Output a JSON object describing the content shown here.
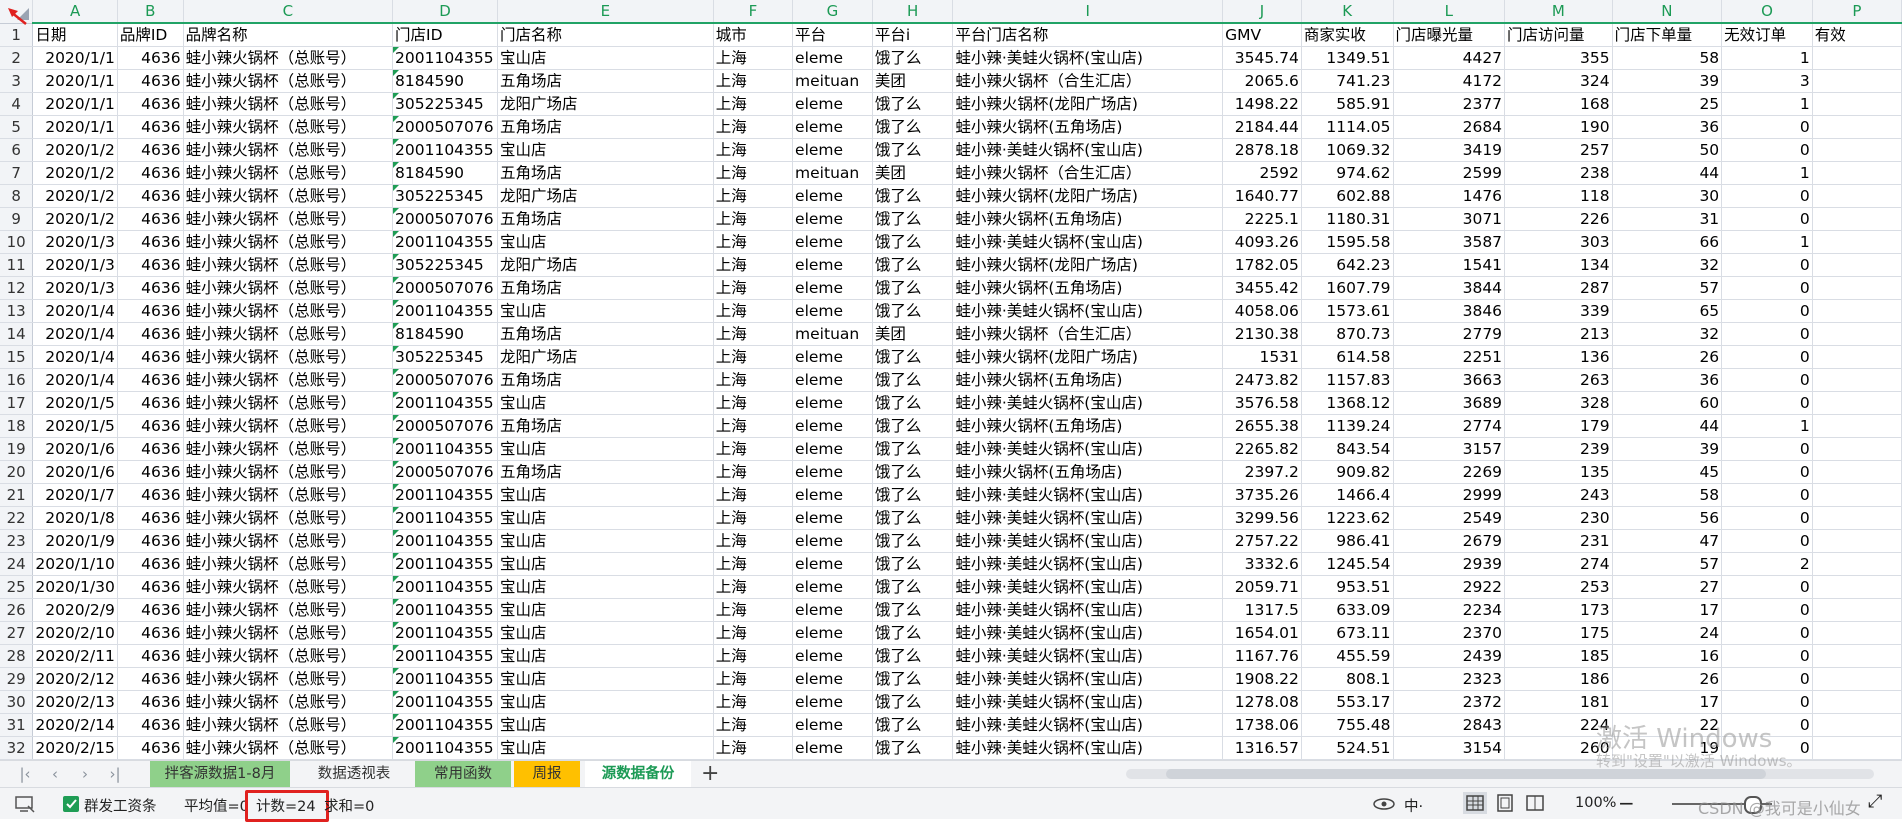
{
  "columns": [
    "A",
    "B",
    "C",
    "D",
    "E",
    "F",
    "G",
    "H",
    "I",
    "J",
    "K",
    "L",
    "M",
    "N",
    "O",
    "P"
  ],
  "header_row": [
    "日期",
    "品牌ID",
    "品牌名称",
    "门店ID",
    "门店名称",
    "城市",
    "平台",
    "平台i",
    "平台门店名称",
    "GMV",
    "商家实收",
    "门店曝光量",
    "门店访问量",
    "门店下单量",
    "无效订单",
    "有效"
  ],
  "rows": [
    [
      "2",
      "2020/1/1",
      "4636",
      "蛙小辣火锅杯（总账号）",
      "2001104355",
      "宝山店",
      "上海",
      "eleme",
      "饿了么",
      "蛙小辣·美蛙火锅杯(宝山店)",
      "3545.74",
      "1349.51",
      "4427",
      "355",
      "58",
      "1"
    ],
    [
      "3",
      "2020/1/1",
      "4636",
      "蛙小辣火锅杯（总账号）",
      "8184590",
      "五角场店",
      "上海",
      "meituan",
      "美团",
      "蛙小辣火锅杯（合生汇店）",
      "2065.6",
      "741.23",
      "4172",
      "324",
      "39",
      "3"
    ],
    [
      "4",
      "2020/1/1",
      "4636",
      "蛙小辣火锅杯（总账号）",
      "305225345",
      "龙阳广场店",
      "上海",
      "eleme",
      "饿了么",
      "蛙小辣火锅杯(龙阳广场店)",
      "1498.22",
      "585.91",
      "2377",
      "168",
      "25",
      "1"
    ],
    [
      "5",
      "2020/1/1",
      "4636",
      "蛙小辣火锅杯（总账号）",
      "2000507076",
      "五角场店",
      "上海",
      "eleme",
      "饿了么",
      "蛙小辣火锅杯(五角场店)",
      "2184.44",
      "1114.05",
      "2684",
      "190",
      "36",
      "0"
    ],
    [
      "6",
      "2020/1/2",
      "4636",
      "蛙小辣火锅杯（总账号）",
      "2001104355",
      "宝山店",
      "上海",
      "eleme",
      "饿了么",
      "蛙小辣·美蛙火锅杯(宝山店)",
      "2878.18",
      "1069.32",
      "3419",
      "257",
      "50",
      "0"
    ],
    [
      "7",
      "2020/1/2",
      "4636",
      "蛙小辣火锅杯（总账号）",
      "8184590",
      "五角场店",
      "上海",
      "meituan",
      "美团",
      "蛙小辣火锅杯（合生汇店）",
      "2592",
      "974.62",
      "2599",
      "238",
      "44",
      "1"
    ],
    [
      "8",
      "2020/1/2",
      "4636",
      "蛙小辣火锅杯（总账号）",
      "305225345",
      "龙阳广场店",
      "上海",
      "eleme",
      "饿了么",
      "蛙小辣火锅杯(龙阳广场店)",
      "1640.77",
      "602.88",
      "1476",
      "118",
      "30",
      "0"
    ],
    [
      "9",
      "2020/1/2",
      "4636",
      "蛙小辣火锅杯（总账号）",
      "2000507076",
      "五角场店",
      "上海",
      "eleme",
      "饿了么",
      "蛙小辣火锅杯(五角场店)",
      "2225.1",
      "1180.31",
      "3071",
      "226",
      "31",
      "0"
    ],
    [
      "10",
      "2020/1/3",
      "4636",
      "蛙小辣火锅杯（总账号）",
      "2001104355",
      "宝山店",
      "上海",
      "eleme",
      "饿了么",
      "蛙小辣·美蛙火锅杯(宝山店)",
      "4093.26",
      "1595.58",
      "3587",
      "303",
      "66",
      "1"
    ],
    [
      "11",
      "2020/1/3",
      "4636",
      "蛙小辣火锅杯（总账号）",
      "305225345",
      "龙阳广场店",
      "上海",
      "eleme",
      "饿了么",
      "蛙小辣火锅杯(龙阳广场店)",
      "1782.05",
      "642.23",
      "1541",
      "134",
      "32",
      "0"
    ],
    [
      "12",
      "2020/1/3",
      "4636",
      "蛙小辣火锅杯（总账号）",
      "2000507076",
      "五角场店",
      "上海",
      "eleme",
      "饿了么",
      "蛙小辣火锅杯(五角场店)",
      "3455.42",
      "1607.79",
      "3844",
      "287",
      "57",
      "0"
    ],
    [
      "13",
      "2020/1/4",
      "4636",
      "蛙小辣火锅杯（总账号）",
      "2001104355",
      "宝山店",
      "上海",
      "eleme",
      "饿了么",
      "蛙小辣·美蛙火锅杯(宝山店)",
      "4058.06",
      "1573.61",
      "3846",
      "339",
      "65",
      "0"
    ],
    [
      "14",
      "2020/1/4",
      "4636",
      "蛙小辣火锅杯（总账号）",
      "8184590",
      "五角场店",
      "上海",
      "meituan",
      "美团",
      "蛙小辣火锅杯（合生汇店）",
      "2130.38",
      "870.73",
      "2779",
      "213",
      "32",
      "0"
    ],
    [
      "15",
      "2020/1/4",
      "4636",
      "蛙小辣火锅杯（总账号）",
      "305225345",
      "龙阳广场店",
      "上海",
      "eleme",
      "饿了么",
      "蛙小辣火锅杯(龙阳广场店)",
      "1531",
      "614.58",
      "2251",
      "136",
      "26",
      "0"
    ],
    [
      "16",
      "2020/1/4",
      "4636",
      "蛙小辣火锅杯（总账号）",
      "2000507076",
      "五角场店",
      "上海",
      "eleme",
      "饿了么",
      "蛙小辣火锅杯(五角场店)",
      "2473.82",
      "1157.83",
      "3663",
      "263",
      "36",
      "0"
    ],
    [
      "17",
      "2020/1/5",
      "4636",
      "蛙小辣火锅杯（总账号）",
      "2001104355",
      "宝山店",
      "上海",
      "eleme",
      "饿了么",
      "蛙小辣·美蛙火锅杯(宝山店)",
      "3576.58",
      "1368.12",
      "3689",
      "328",
      "60",
      "0"
    ],
    [
      "18",
      "2020/1/5",
      "4636",
      "蛙小辣火锅杯（总账号）",
      "2000507076",
      "五角场店",
      "上海",
      "eleme",
      "饿了么",
      "蛙小辣火锅杯(五角场店)",
      "2655.38",
      "1139.24",
      "2774",
      "179",
      "44",
      "1"
    ],
    [
      "19",
      "2020/1/6",
      "4636",
      "蛙小辣火锅杯（总账号）",
      "2001104355",
      "宝山店",
      "上海",
      "eleme",
      "饿了么",
      "蛙小辣·美蛙火锅杯(宝山店)",
      "2265.82",
      "843.54",
      "3157",
      "239",
      "39",
      "0"
    ],
    [
      "20",
      "2020/1/6",
      "4636",
      "蛙小辣火锅杯（总账号）",
      "2000507076",
      "五角场店",
      "上海",
      "eleme",
      "饿了么",
      "蛙小辣火锅杯(五角场店)",
      "2397.2",
      "909.82",
      "2269",
      "135",
      "45",
      "0"
    ],
    [
      "21",
      "2020/1/7",
      "4636",
      "蛙小辣火锅杯（总账号）",
      "2001104355",
      "宝山店",
      "上海",
      "eleme",
      "饿了么",
      "蛙小辣·美蛙火锅杯(宝山店)",
      "3735.26",
      "1466.4",
      "2999",
      "243",
      "58",
      "0"
    ],
    [
      "22",
      "2020/1/8",
      "4636",
      "蛙小辣火锅杯（总账号）",
      "2001104355",
      "宝山店",
      "上海",
      "eleme",
      "饿了么",
      "蛙小辣·美蛙火锅杯(宝山店)",
      "3299.56",
      "1223.62",
      "2549",
      "230",
      "56",
      "0"
    ],
    [
      "23",
      "2020/1/9",
      "4636",
      "蛙小辣火锅杯（总账号）",
      "2001104355",
      "宝山店",
      "上海",
      "eleme",
      "饿了么",
      "蛙小辣·美蛙火锅杯(宝山店)",
      "2757.22",
      "986.41",
      "2679",
      "231",
      "47",
      "0"
    ],
    [
      "24",
      "2020/1/10",
      "4636",
      "蛙小辣火锅杯（总账号）",
      "2001104355",
      "宝山店",
      "上海",
      "eleme",
      "饿了么",
      "蛙小辣·美蛙火锅杯(宝山店)",
      "3332.6",
      "1245.54",
      "2939",
      "274",
      "57",
      "2"
    ],
    [
      "25",
      "2020/1/30",
      "4636",
      "蛙小辣火锅杯（总账号）",
      "2001104355",
      "宝山店",
      "上海",
      "eleme",
      "饿了么",
      "蛙小辣·美蛙火锅杯(宝山店)",
      "2059.71",
      "953.51",
      "2922",
      "253",
      "27",
      "0"
    ],
    [
      "26",
      "2020/2/9",
      "4636",
      "蛙小辣火锅杯（总账号）",
      "2001104355",
      "宝山店",
      "上海",
      "eleme",
      "饿了么",
      "蛙小辣·美蛙火锅杯(宝山店)",
      "1317.5",
      "633.09",
      "2234",
      "173",
      "17",
      "0"
    ],
    [
      "27",
      "2020/2/10",
      "4636",
      "蛙小辣火锅杯（总账号）",
      "2001104355",
      "宝山店",
      "上海",
      "eleme",
      "饿了么",
      "蛙小辣·美蛙火锅杯(宝山店)",
      "1654.01",
      "673.11",
      "2370",
      "175",
      "24",
      "0"
    ],
    [
      "28",
      "2020/2/11",
      "4636",
      "蛙小辣火锅杯（总账号）",
      "2001104355",
      "宝山店",
      "上海",
      "eleme",
      "饿了么",
      "蛙小辣·美蛙火锅杯(宝山店)",
      "1167.76",
      "455.59",
      "2439",
      "185",
      "16",
      "0"
    ],
    [
      "29",
      "2020/2/12",
      "4636",
      "蛙小辣火锅杯（总账号）",
      "2001104355",
      "宝山店",
      "上海",
      "eleme",
      "饿了么",
      "蛙小辣·美蛙火锅杯(宝山店)",
      "1908.22",
      "808.1",
      "2323",
      "186",
      "26",
      "0"
    ],
    [
      "30",
      "2020/2/13",
      "4636",
      "蛙小辣火锅杯（总账号）",
      "2001104355",
      "宝山店",
      "上海",
      "eleme",
      "饿了么",
      "蛙小辣·美蛙火锅杯(宝山店)",
      "1278.08",
      "553.17",
      "2372",
      "181",
      "17",
      "0"
    ],
    [
      "31",
      "2020/2/14",
      "4636",
      "蛙小辣火锅杯（总账号）",
      "2001104355",
      "宝山店",
      "上海",
      "eleme",
      "饿了么",
      "蛙小辣·美蛙火锅杯(宝山店)",
      "1738.06",
      "755.48",
      "2843",
      "224",
      "22",
      "0"
    ],
    [
      "32",
      "2020/2/15",
      "4636",
      "蛙小辣火锅杯（总账号）",
      "2001104355",
      "宝山店",
      "上海",
      "eleme",
      "饿了么",
      "蛙小辣·美蛙火锅杯(宝山店)",
      "1316.57",
      "524.51",
      "3154",
      "260",
      "19",
      "0"
    ]
  ],
  "sheet_tabs": [
    {
      "label": "拌客源数据1-8月",
      "bg": "#8fd08a",
      "active": false
    },
    {
      "label": "数据透视表",
      "bg": "#f3f4f6",
      "active": false
    },
    {
      "label": "常用函数",
      "bg": "#8fd08a",
      "active": false
    },
    {
      "label": "周报",
      "bg": "#ffc000",
      "active": false
    },
    {
      "label": "源数据备份",
      "bg": "#ffffff",
      "active": true
    }
  ],
  "status": {
    "app_label": "群发工资条",
    "average": "平均值=0",
    "count": "计数=24",
    "sum": "求和=0",
    "zoom": "100%",
    "ime": "中·"
  },
  "watermark": {
    "line1": "激活 Windows",
    "line2": "转到\"设置\"以激活 Windows。",
    "csdn": "CSDN @我可是小仙女"
  },
  "colors": {
    "accent_green": "#21a366",
    "highlight_red": "#e0211f"
  }
}
